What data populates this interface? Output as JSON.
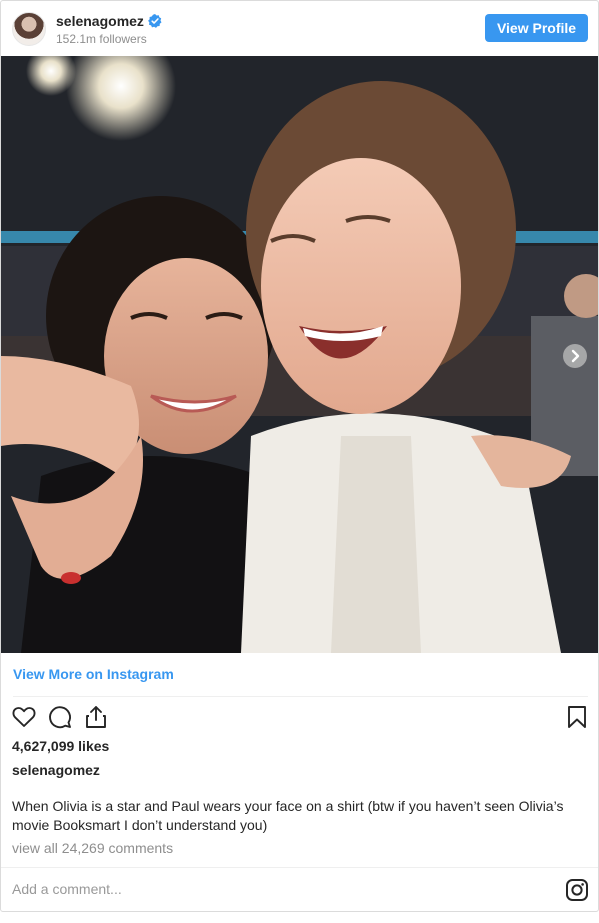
{
  "header": {
    "username": "selenagomez",
    "followers": "152.1m followers",
    "view_profile_label": "View Profile",
    "verified_color": "#3897f0"
  },
  "photo": {
    "description_icon": "instagram-post-photo",
    "next_icon": "chevron-right-icon"
  },
  "footer": {
    "view_more_label": "View More on Instagram",
    "likes": "4,627,099 likes",
    "caption_user": "selenagomez",
    "caption_text": "When Olivia is a star and Paul wears your face on a shirt (btw if you haven’t seen Olivia’s movie Booksmart I don’t understand you)",
    "view_comments": "view all 24,269 comments",
    "comment_placeholder": "Add a comment..."
  },
  "actions": [
    "heart-icon",
    "comment-icon",
    "share-icon",
    "bookmark-icon"
  ],
  "colors": {
    "accent": "#3897f0",
    "text": "#262626",
    "muted": "#8e8e8e"
  }
}
